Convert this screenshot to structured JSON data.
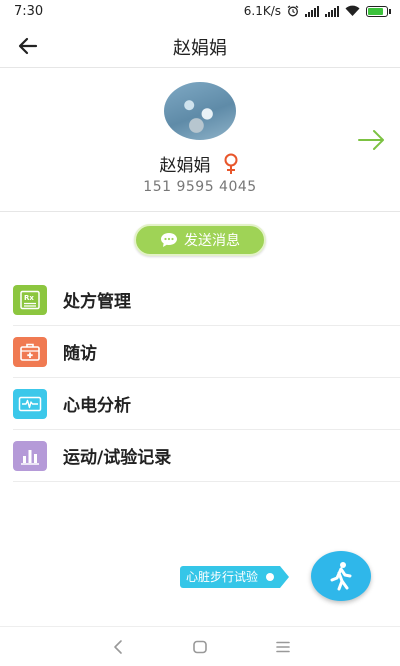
{
  "status_bar": {
    "time": "7:30",
    "net_speed": "6.1K/s",
    "battery_color": "#3cc23c"
  },
  "header": {
    "title": "赵娟娟",
    "back_icon": "arrow-left-icon"
  },
  "profile": {
    "name": "赵娟娟",
    "gender_icon": "female-icon",
    "gender_color": "#e8562b",
    "phone": "151 9595 4045",
    "forward_icon": "arrow-right-icon",
    "forward_color": "#7cc242"
  },
  "send_message": {
    "label": "发送消息",
    "icon": "chat-bubble-icon",
    "color": "#9fd356"
  },
  "menu": [
    {
      "label": "处方管理",
      "icon": "prescription-icon",
      "color": "#8cc63f"
    },
    {
      "label": "随访",
      "icon": "medical-kit-icon",
      "color": "#f07a52"
    },
    {
      "label": "心电分析",
      "icon": "ecg-icon",
      "color": "#3cc8ea"
    },
    {
      "label": "运动/试验记录",
      "icon": "bar-chart-icon",
      "color": "#b59ad8"
    }
  ],
  "walk_test": {
    "label": "心脏步行试验",
    "icon": "walking-person-icon",
    "color": "#2fb7ea"
  },
  "nav_bar": {
    "back_icon": "nav-back-icon",
    "home_icon": "nav-home-icon",
    "menu_icon": "nav-menu-icon"
  }
}
